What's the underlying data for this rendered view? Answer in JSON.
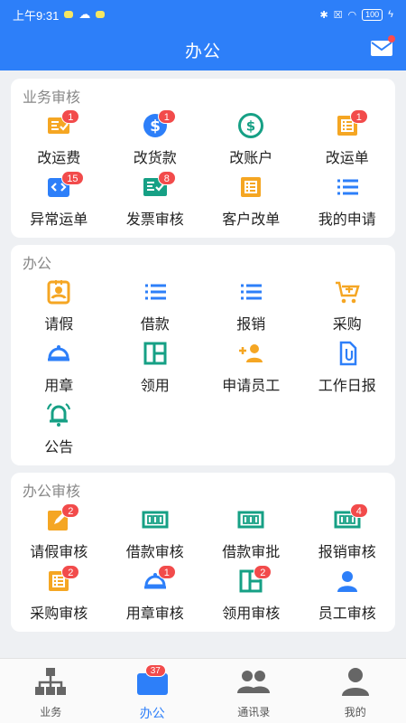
{
  "status_bar": {
    "time": "上午9:31",
    "battery": "100"
  },
  "header": {
    "title": "办公"
  },
  "colors": {
    "primary": "#2d7ff9",
    "orange": "#f5a623",
    "teal": "#16a085",
    "badge": "#f24b4b"
  },
  "sections": [
    {
      "title": "业务审核",
      "items": [
        {
          "label": "改运费",
          "badge": "1",
          "icon": "doc-check-icon"
        },
        {
          "label": "改货款",
          "badge": "1",
          "icon": "dollar-circle-icon"
        },
        {
          "label": "改账户",
          "badge": "",
          "icon": "dollar-circle-outline-icon"
        },
        {
          "label": "改运单",
          "badge": "1",
          "icon": "list-doc-icon"
        },
        {
          "label": "异常运单",
          "badge": "15",
          "icon": "code-box-icon"
        },
        {
          "label": "发票审核",
          "badge": "8",
          "icon": "invoice-check-icon"
        },
        {
          "label": "客户改单",
          "badge": "",
          "icon": "list-doc-icon"
        },
        {
          "label": "我的申请",
          "badge": "",
          "icon": "list-icon"
        }
      ]
    },
    {
      "title": "办公",
      "items": [
        {
          "label": "请假",
          "badge": "",
          "icon": "id-card-icon"
        },
        {
          "label": "借款",
          "badge": "",
          "icon": "list-icon"
        },
        {
          "label": "报销",
          "badge": "",
          "icon": "list-icon"
        },
        {
          "label": "采购",
          "badge": "",
          "icon": "cart-plus-icon"
        },
        {
          "label": "用章",
          "badge": "",
          "icon": "stamp-icon"
        },
        {
          "label": "领用",
          "badge": "",
          "icon": "layout-icon"
        },
        {
          "label": "申请员工",
          "badge": "",
          "icon": "add-user-icon"
        },
        {
          "label": "工作日报",
          "badge": "",
          "icon": "paperclip-doc-icon"
        },
        {
          "label": "公告",
          "badge": "",
          "icon": "bell-icon"
        }
      ]
    },
    {
      "title": "办公审核",
      "items": [
        {
          "label": "请假审核",
          "badge": "2",
          "icon": "edit-icon"
        },
        {
          "label": "借款审核",
          "badge": "",
          "icon": "money-icon"
        },
        {
          "label": "借款审批",
          "badge": "",
          "icon": "money-icon"
        },
        {
          "label": "报销审核",
          "badge": "4",
          "icon": "money-icon"
        },
        {
          "label": "采购审核",
          "badge": "2",
          "icon": "list-doc-icon"
        },
        {
          "label": "用章审核",
          "badge": "1",
          "icon": "stamp-icon"
        },
        {
          "label": "领用审核",
          "badge": "2",
          "icon": "layout-icon"
        },
        {
          "label": "员工审核",
          "badge": "",
          "icon": "user-icon"
        }
      ]
    }
  ],
  "tabs": [
    {
      "label": "业务",
      "icon": "org-chart-icon",
      "badge": "",
      "active": false
    },
    {
      "label": "办公",
      "icon": "briefcase-icon",
      "badge": "37",
      "active": true
    },
    {
      "label": "通讯录",
      "icon": "contacts-icon",
      "badge": "",
      "active": false
    },
    {
      "label": "我的",
      "icon": "profile-icon",
      "badge": "",
      "active": false
    }
  ]
}
